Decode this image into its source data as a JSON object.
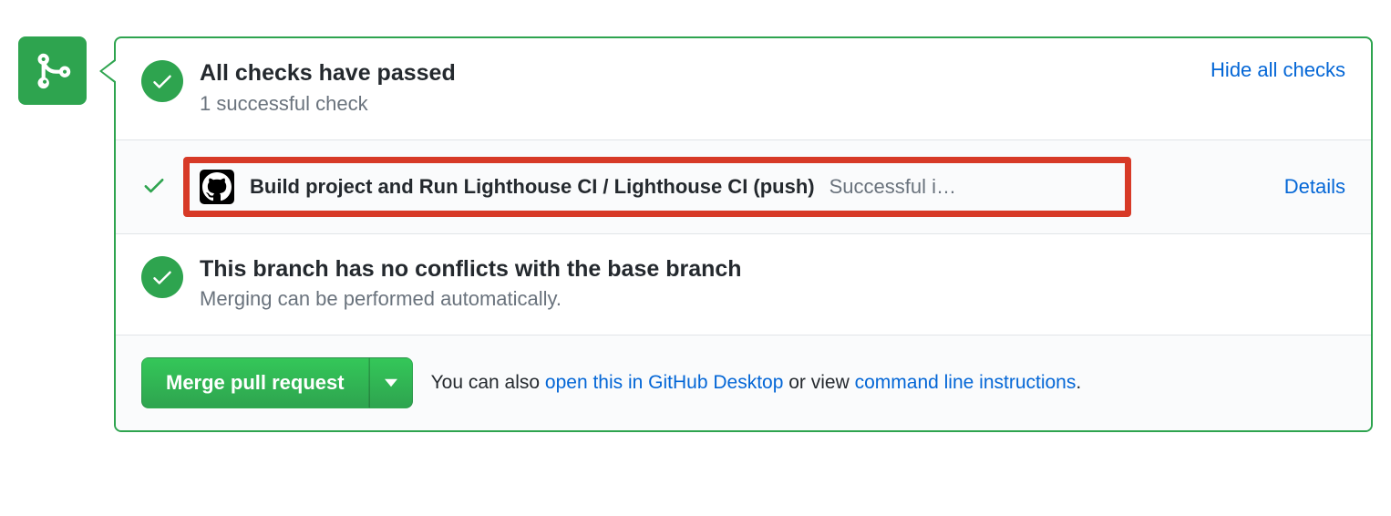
{
  "checks": {
    "title": "All checks have passed",
    "subtitle": "1 successful check",
    "toggle_link": "Hide all checks",
    "items": [
      {
        "name": "Build project and Run Lighthouse CI / Lighthouse CI (push)",
        "status": "Successful i…",
        "details_label": "Details"
      }
    ]
  },
  "conflicts": {
    "title": "This branch has no conflicts with the base branch",
    "subtitle": "Merging can be performed automatically."
  },
  "merge": {
    "button_label": "Merge pull request",
    "hint_prefix": "You can also ",
    "open_desktop": "open this in GitHub Desktop",
    "hint_middle": " or view ",
    "cli_link": "command line instructions",
    "hint_suffix": "."
  }
}
